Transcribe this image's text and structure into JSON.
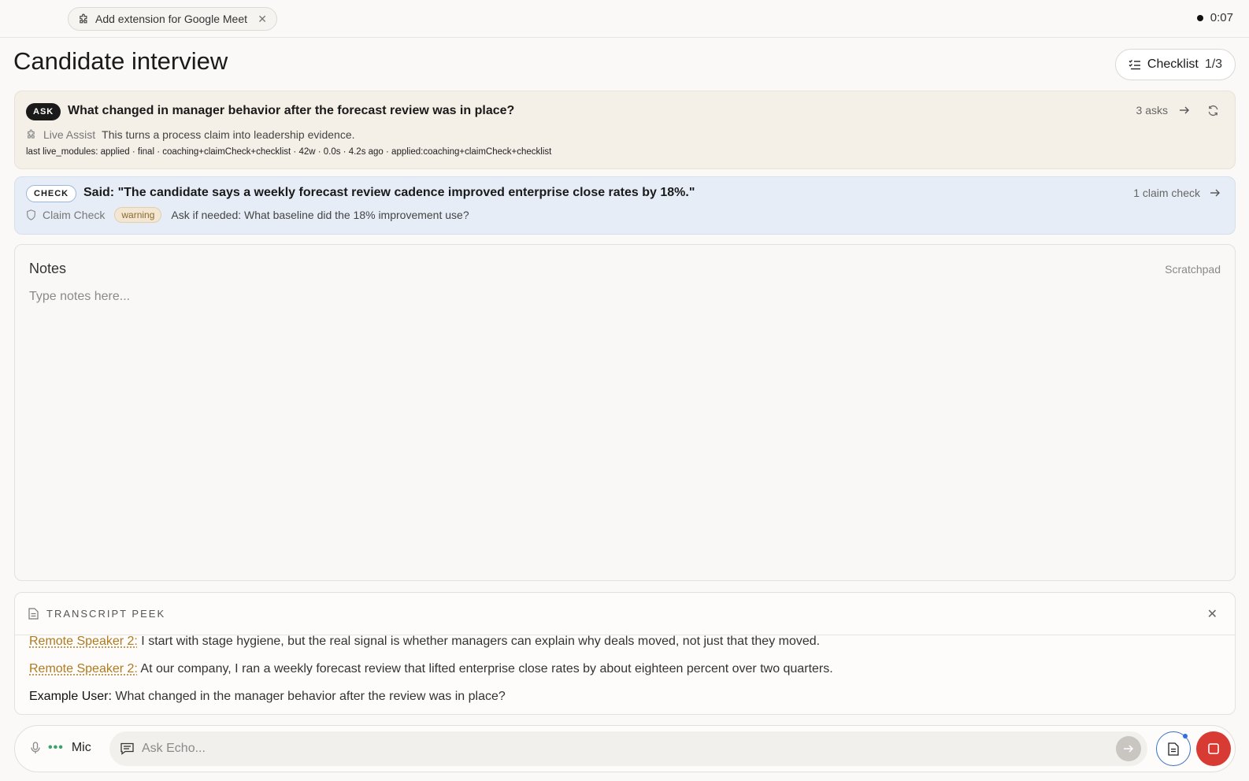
{
  "topbar": {
    "extension_label": "Add extension for Google Meet",
    "timer": "0:07"
  },
  "page": {
    "title": "Candidate interview",
    "checklist_label": "Checklist",
    "checklist_count": "1/3"
  },
  "ask_card": {
    "badge": "ASK",
    "question": "What changed in manager behavior after the forecast review was in place?",
    "asks_count": "3 asks",
    "assist_label": "Live Assist",
    "assist_text": "This turns a process claim into leadership evidence.",
    "meta": "last live_modules: applied · final · coaching+claimCheck+checklist · 42w · 0.0s · 4.2s ago · applied:coaching+claimCheck+checklist"
  },
  "check_card": {
    "badge": "CHECK",
    "said": "Said: \"The candidate says a weekly forecast review cadence improved enterprise close rates by 18%.\"",
    "claim_count": "1 claim check",
    "check_label": "Claim Check",
    "status": "warning",
    "followup": "Ask if needed: What baseline did the 18% improvement use?"
  },
  "notes": {
    "title": "Notes",
    "tag": "Scratchpad",
    "placeholder": "Type notes here..."
  },
  "transcript": {
    "title": "TRANSCRIPT PEEK",
    "lines": [
      {
        "speaker": "Remote Speaker 2:",
        "text": " I start with stage hygiene, but the real signal is whether managers can explain why deals moved, not just that they moved."
      },
      {
        "speaker": "Remote Speaker 2:",
        "text": " At our company, I ran a weekly forecast review that lifted enterprise close rates by about eighteen percent over two quarters."
      },
      {
        "speaker": "Example User:",
        "text": " What changed in the manager behavior after the review was in place?"
      }
    ]
  },
  "bottombar": {
    "mic_label": "Mic",
    "ask_placeholder": "Ask Echo..."
  },
  "colors": {
    "ask_card_bg": "#f4efe7",
    "check_card_bg": "#e6edf6",
    "speaker_accent": "#b07a1e",
    "stop_red": "#d83a34",
    "mic_green": "#3aa56b"
  }
}
